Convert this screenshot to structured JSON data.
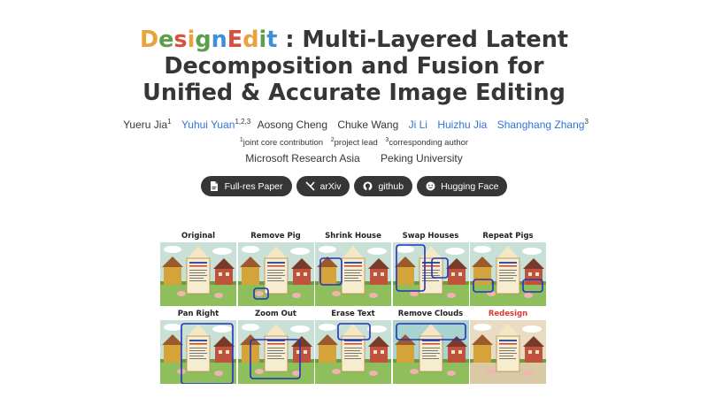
{
  "title": {
    "brand_letters": [
      "D",
      "e",
      "s",
      "i",
      "g",
      "n",
      "E",
      "d",
      "i",
      "t"
    ],
    "brand_colors": [
      "#e8a33a",
      "#5aa04a",
      "#d94f3d",
      "#e8a33a",
      "#5aa04a",
      "#3e8fd6",
      "#d94f3d",
      "#e8a33a",
      "#5aa04a",
      "#3e8fd6"
    ],
    "line1_rest": ": Multi-Layered Latent",
    "line2": "Decomposition and Fusion for",
    "line3": "Unified & Accurate Image Editing"
  },
  "authors": [
    {
      "name": "Yueru Jia",
      "sup": "1",
      "link": false
    },
    {
      "name": "Yuhui Yuan",
      "sup": "1,2,3",
      "link": true
    },
    {
      "name": "Aosong Cheng",
      "sup": "",
      "link": false
    },
    {
      "name": "Chuke Wang",
      "sup": "",
      "link": false
    },
    {
      "name": "Ji Li",
      "sup": "",
      "link": true
    },
    {
      "name": "Huizhu Jia",
      "sup": "",
      "link": true
    },
    {
      "name": "Shanghang Zhang",
      "sup": "3",
      "link": true
    }
  ],
  "notes": [
    {
      "sup": "1",
      "text": "joint core contribution"
    },
    {
      "sup": "2",
      "text": "project lead"
    },
    {
      "sup": "3",
      "text": "corresponding author"
    }
  ],
  "affiliations": [
    "Microsoft Research Asia",
    "Peking University"
  ],
  "buttons": [
    {
      "label": "Full-res Paper",
      "icon": "file-pdf-icon"
    },
    {
      "label": "arXiv",
      "icon": "arxiv-icon"
    },
    {
      "label": "github",
      "icon": "github-icon"
    },
    {
      "label": "Hugging Face",
      "icon": "hugging-face-icon"
    }
  ],
  "figure": {
    "row1": [
      "Original",
      "Remove Pig",
      "Shrink House",
      "Swap Houses",
      "Repeat Pigs"
    ],
    "row2": [
      "Pan Right",
      "Zoom Out",
      "Erase Text",
      "Remove Clouds",
      "Redesign"
    ],
    "highlight_color": "#e0362f",
    "box_color": "#2233bb"
  }
}
